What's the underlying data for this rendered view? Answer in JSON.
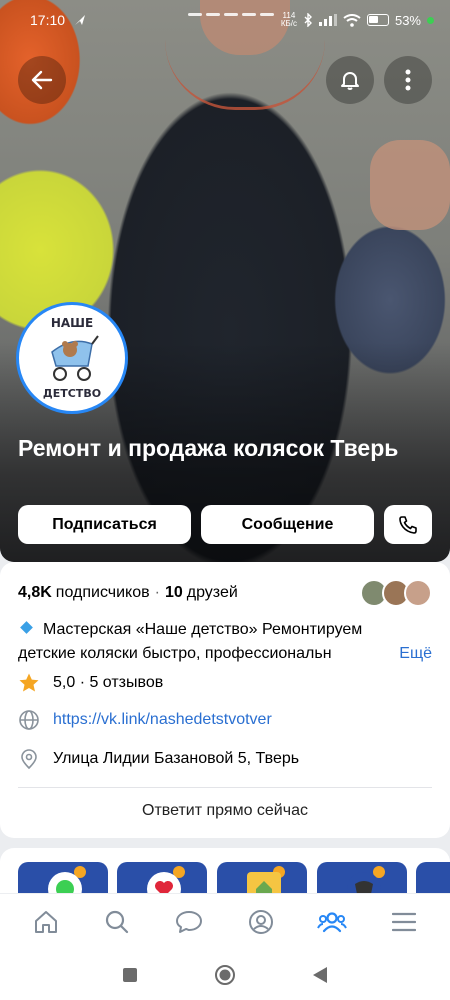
{
  "status": {
    "time": "17:10",
    "net_speed": "114\nКБ/с",
    "battery": "53%"
  },
  "group": {
    "name": "Ремонт и продажа колясок Тверь",
    "avatar_top": "НАШЕ",
    "avatar_bottom": "ДЕТСТВО"
  },
  "actions": {
    "subscribe": "Подписаться",
    "message": "Сообщение"
  },
  "stats": {
    "subscribers_count": "4,8K",
    "subscribers_label": "подписчиков",
    "sep": "·",
    "friends_count": "10",
    "friends_label": "друзей"
  },
  "description": {
    "line1": "Мастерская «Наше детство» Ремонтируем",
    "line2": "детские коляски быстро, профессиональн",
    "more": "Ещё"
  },
  "rating": {
    "text": "5,0 · 5 отзывов"
  },
  "website": "https://vk.link/nashedetstvotver",
  "address": "Улица Лидии Базановой 5, Тверь",
  "reply_note": "Ответит прямо сейчас",
  "colors": {
    "accent": "#2787f5",
    "link": "#2a6fd1",
    "star": "#f5a623",
    "tab_active": "#2787f5",
    "tab_inactive": "#818c99"
  },
  "icons": {
    "back": "back-arrow-icon",
    "bell": "bell-icon",
    "more": "more-vertical-icon",
    "phone": "phone-icon",
    "globe": "globe-icon",
    "location": "location-pin-icon",
    "star": "star-icon",
    "tabs": [
      "home-icon",
      "search-icon",
      "messages-icon",
      "profile-icon",
      "community-icon",
      "menu-icon"
    ]
  }
}
